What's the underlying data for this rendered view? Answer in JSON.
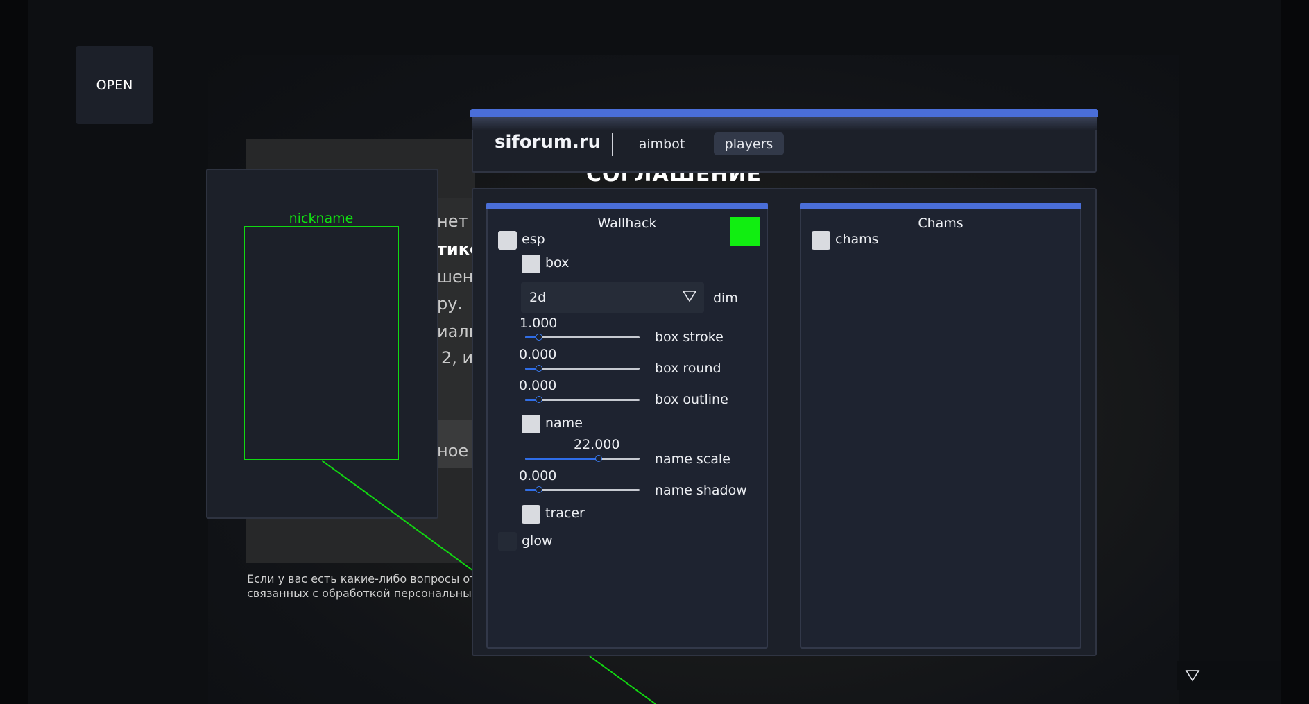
{
  "background": {
    "heading_fragment": "СОГЛАШЕНИЕ",
    "fragments": [
      "нет",
      "тикс",
      "шен",
      "ру.",
      "иаль",
      "2, и",
      "ное с"
    ],
    "footer_lines": [
      "Если у вас есть какие-либо вопросы относ",
      "связанных с обработкой персональных да"
    ]
  },
  "open_button": {
    "label": "OPEN"
  },
  "preview": {
    "nickname": "nickname"
  },
  "header": {
    "brand": "siforum.ru",
    "tabs": [
      {
        "label": "aimbot",
        "active": false
      },
      {
        "label": "players",
        "active": true
      }
    ]
  },
  "wallhack": {
    "title": "Wallhack",
    "color": "#11ee11",
    "esp_label": "esp",
    "box_label": "box",
    "dim_value": "2d",
    "dim_label": "dim",
    "sliders": [
      {
        "value": "1.000",
        "label": "box stroke",
        "fraction": 0.12
      },
      {
        "value": "0.000",
        "label": "box round",
        "fraction": 0.12
      },
      {
        "value": "0.000",
        "label": "box outline",
        "fraction": 0.12
      },
      {
        "value": "22.000",
        "label": "name scale",
        "fraction": 0.64
      },
      {
        "value": "0.000",
        "label": "name shadow",
        "fraction": 0.12
      }
    ],
    "name_label": "name",
    "tracer_label": "tracer",
    "glow_label": "glow"
  },
  "chams": {
    "title": "Chams",
    "chams_label": "chams"
  },
  "colors": {
    "accent": "#4a6ed8",
    "esp_green": "#11ee11",
    "panel_bg": "#1c2029"
  }
}
